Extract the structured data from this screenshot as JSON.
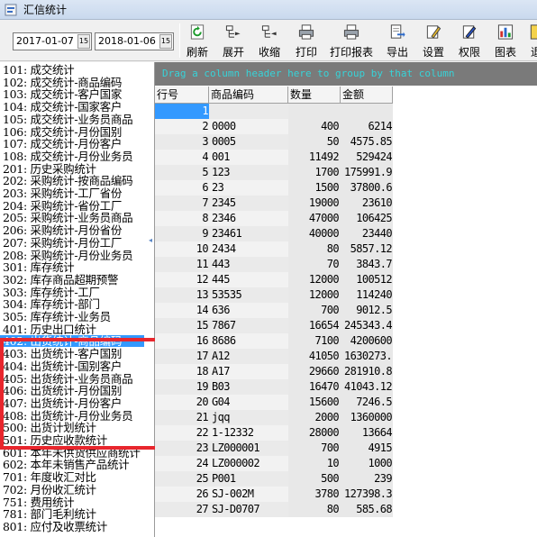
{
  "window": {
    "title": "汇信统计"
  },
  "toolbar": {
    "date_from": "2017-01-07",
    "date_to": "2018-01-06",
    "cal_glyph": "15",
    "buttons": [
      {
        "label": "刷新",
        "icon": "refresh-icon"
      },
      {
        "label": "展开",
        "icon": "expand-icon"
      },
      {
        "label": "收缩",
        "icon": "collapse-icon"
      },
      {
        "label": "打印",
        "icon": "print-icon"
      },
      {
        "label": "打印报表",
        "icon": "print-report-icon"
      },
      {
        "label": "导出",
        "icon": "export-icon"
      },
      {
        "label": "设置",
        "icon": "settings-icon"
      },
      {
        "label": "权限",
        "icon": "permission-icon"
      },
      {
        "label": "图表",
        "icon": "chart-icon"
      },
      {
        "label": "退",
        "icon": "exit-icon"
      }
    ]
  },
  "nav": {
    "items": [
      "101: 成交统计",
      "102: 成交统计-商品编码",
      "103: 成交统计-客户国家",
      "104: 成交统计-国家客户",
      "105: 成交统计-业务员商品",
      "106: 成交统计-月份国别",
      "107: 成交统计-月份客户",
      "108: 成交统计-月份业务员",
      "201: 历史采购统计",
      "202: 采购统计-按商品编码",
      "203: 采购统计-工厂省份",
      "204: 采购统计-省份工厂",
      "205: 采购统计-业务员商品",
      "206: 采购统计-月份省份",
      "207: 采购统计-月份工厂",
      "208: 采购统计-月份业务员",
      "301: 库存统计",
      "302: 库存商品超期预警",
      "303: 库存统计-工厂",
      "304: 库存统计-部门",
      "305: 库存统计-业务员",
      "401: 历史出口统计",
      "402: 出货统计-商品编码",
      "403: 出货统计-客户国别",
      "404: 出货统计-国别客户",
      "405: 出货统计-业务员商品",
      "406: 出货统计-月份国别",
      "407: 出货统计-月份客户",
      "408: 出货统计-月份业务员",
      "500: 出货计划统计",
      "501: 历史应收款统计",
      "601: 本年未供货供应商统计",
      "602: 本年未销售产品统计",
      "701: 年度收汇对比",
      "702: 月份收汇统计",
      "751: 费用统计",
      "781: 部门毛利统计",
      "801: 应付及收票统计"
    ],
    "selected_index": 22
  },
  "grid": {
    "group_hint": "Drag a column header here to group by that column",
    "columns": [
      "行号",
      "商品编码",
      "数量",
      "金额"
    ],
    "rows": [
      [
        "1",
        "",
        "",
        ""
      ],
      [
        "2",
        "0000",
        "400",
        "6214"
      ],
      [
        "3",
        "0005",
        "50",
        "4575.85"
      ],
      [
        "4",
        "001",
        "11492",
        "529424"
      ],
      [
        "5",
        "123",
        "1700",
        "175991.9"
      ],
      [
        "6",
        "23",
        "1500",
        "37800.6"
      ],
      [
        "7",
        "2345",
        "19000",
        "23610"
      ],
      [
        "8",
        "2346",
        "47000",
        "106425"
      ],
      [
        "9",
        "23461",
        "40000",
        "23440"
      ],
      [
        "10",
        "2434",
        "80",
        "5857.12"
      ],
      [
        "11",
        "443",
        "70",
        "3843.7"
      ],
      [
        "12",
        "445",
        "12000",
        "100512"
      ],
      [
        "13",
        "53535",
        "12000",
        "114240"
      ],
      [
        "14",
        "636",
        "700",
        "9012.5"
      ],
      [
        "15",
        "7867",
        "16654",
        "245343.4"
      ],
      [
        "16",
        "8686",
        "7100",
        "4200600"
      ],
      [
        "17",
        "A12",
        "41050",
        "1630273."
      ],
      [
        "18",
        "A17",
        "29660",
        "281910.8"
      ],
      [
        "19",
        "B03",
        "16470",
        "41043.12"
      ],
      [
        "20",
        "G04",
        "15600",
        "7246.5"
      ],
      [
        "21",
        "jqq",
        "2000",
        "1360000"
      ],
      [
        "22",
        "1-12332",
        "28000",
        "13664"
      ],
      [
        "23",
        "LZ000001",
        "700",
        "4915"
      ],
      [
        "24",
        "LZ000002",
        "10",
        "1000"
      ],
      [
        "25",
        "P001",
        "500",
        "239"
      ],
      [
        "26",
        "SJ-002M",
        "3780",
        "127398.3"
      ],
      [
        "27",
        "SJ-D0707",
        "80",
        "585.68"
      ]
    ],
    "current_row_index": 0
  }
}
